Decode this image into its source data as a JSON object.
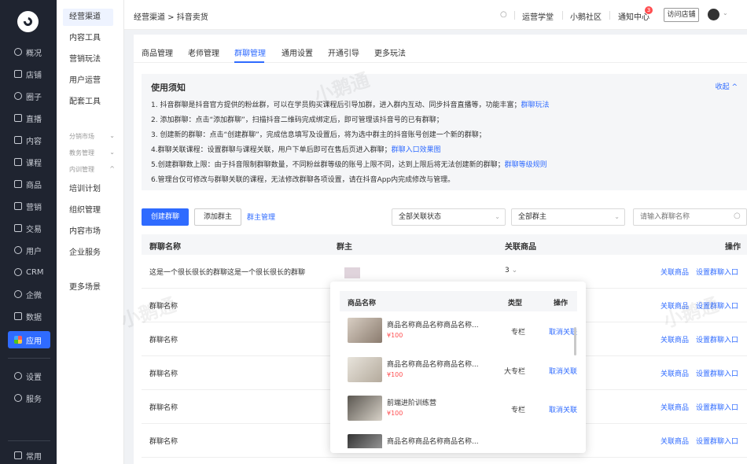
{
  "rail": {
    "items": [
      "概况",
      "店铺",
      "圈子",
      "直播",
      "内容",
      "课程",
      "商品",
      "营销",
      "交易",
      "用户",
      "CRM",
      "企微",
      "数据",
      "应用"
    ],
    "bottom_items": [
      "设置",
      "服务"
    ],
    "footer": "常用"
  },
  "submenu": {
    "items": [
      "经营渠道",
      "内容工具",
      "营销玩法",
      "用户运营",
      "配套工具"
    ],
    "groups": [
      "分销市场",
      "教务管理",
      "内训管理"
    ],
    "items2": [
      "培训计划",
      "组织管理",
      "内容市场",
      "企业服务"
    ],
    "more": "更多场景"
  },
  "topbar": {
    "breadcrumb": "经营渠道 > 抖音卖货",
    "links": [
      "运营学堂",
      "小鹅社区",
      "通知中心"
    ],
    "notice_badge": "3",
    "visit_store": "访问店铺"
  },
  "tabs": [
    "商品管理",
    "老师管理",
    "群聊管理",
    "通用设置",
    "开通引导",
    "更多玩法"
  ],
  "notice": {
    "title": "使用须知",
    "collapse": "收起 ^",
    "lines": [
      {
        "text": "1. 抖音群聊是抖音官方提供的粉丝群，可以在学员购买课程后引导加群，进入群内互动、同步抖音直播等，功能丰富；",
        "link": "群聊玩法"
      },
      {
        "text": "2. 添加群聊：点击“添加群聊”，扫描抖音二维码完成绑定后，即可管理该抖音号的已有群聊；",
        "link": ""
      },
      {
        "text": "3. 创建新的群聊：点击“创建群聊”，完成信息填写及设置后，将为选中群主的抖音账号创建一个新的群聊；",
        "link": ""
      },
      {
        "text": "4.群聊关联课程：设置群聊与课程关联，用户下单后即可在售后页进入群聊；",
        "link": "群聊入口效果图"
      },
      {
        "text": "5.创建群聊数上限：由于抖音限制群聊数量，不同粉丝群等级的账号上限不同，达到上限后将无法创建新的群聊；",
        "link": "群聊等级规则"
      },
      {
        "text": "6.管理台仅可修改与群聊关联的课程，无法修改群聊各项设置，请在抖音App内完成修改与管理。",
        "link": ""
      }
    ]
  },
  "toolbar": {
    "create": "创建群聊",
    "add_owner": "添加群主",
    "owner_mgmt": "群主管理",
    "status_select": "全部关联状态",
    "owner_select": "全部群主",
    "search_placeholder": "请输入群聊名称"
  },
  "table": {
    "headers": [
      "群聊名称",
      "群主",
      "关联商品",
      "操作"
    ],
    "rows": [
      {
        "name": "这是一个很长很长的群聊这是一个很长很长的群聊",
        "count": "3"
      },
      {
        "name": "群聊名称",
        "count": ""
      },
      {
        "name": "群聊名称",
        "count": ""
      },
      {
        "name": "群聊名称",
        "count": ""
      },
      {
        "name": "群聊名称",
        "count": ""
      },
      {
        "name": "群聊名称",
        "count": ""
      }
    ],
    "op_link_product": "关联商品",
    "op_set_entry": "设置群聊入口"
  },
  "popup": {
    "headers": [
      "商品名称",
      "类型",
      "操作"
    ],
    "items": [
      {
        "name": "商品名称商品名称商品名称...",
        "price": "¥100",
        "type": "专栏",
        "action": "取消关联"
      },
      {
        "name": "商品名称商品名称商品名称...",
        "price": "¥100",
        "type": "大专栏",
        "action": "取消关联"
      },
      {
        "name": "前端进阶训练营",
        "price": "¥100",
        "type": "专栏",
        "action": "取消关联"
      },
      {
        "name": "商品名称商品名称商品名称...",
        "price": "",
        "type": "",
        "action": ""
      }
    ]
  },
  "watermark": "小鹅通"
}
